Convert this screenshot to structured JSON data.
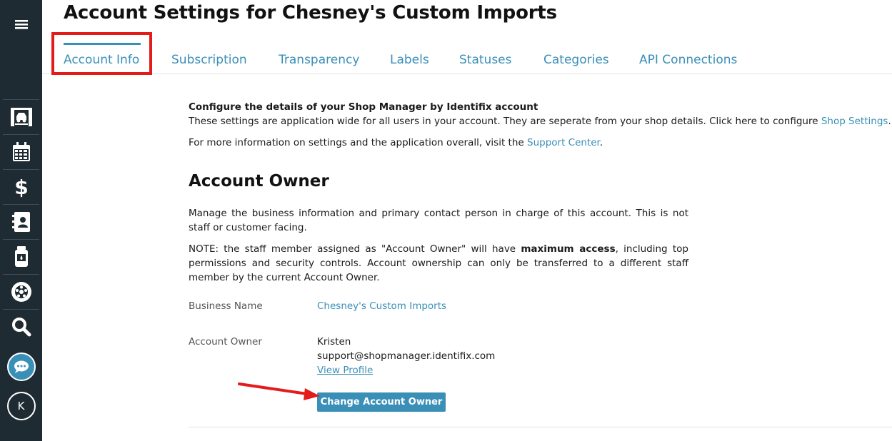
{
  "sidebar": {
    "avatar_letter": "K",
    "icons": [
      "menu-icon",
      "lift-icon",
      "calendar-icon",
      "dollar-icon",
      "contacts-icon",
      "oil-can-icon",
      "tire-icon",
      "search-icon",
      "chat-icon"
    ]
  },
  "header": {
    "title": "Account Settings for Chesney's Custom Imports"
  },
  "tabs": [
    {
      "label": "Account Info",
      "active": true
    },
    {
      "label": "Subscription"
    },
    {
      "label": "Transparency"
    },
    {
      "label": "Labels"
    },
    {
      "label": "Statuses"
    },
    {
      "label": "Categories"
    },
    {
      "label": "API Connections"
    }
  ],
  "intro": {
    "title": "Configure the details of your Shop Manager by Identifix account",
    "text_before_link": "These settings are application wide for all users in your account. They are seperate from your shop details. Click here to configure ",
    "shop_settings_link": "Shop Settings",
    "text_after_link": ".",
    "more_before_link": "For more information on settings and the application overall, visit the ",
    "support_link": "Support Center",
    "more_after_link": "."
  },
  "account_owner": {
    "section_title": "Account Owner",
    "description": "Manage the business information and primary contact person in charge of this account. This is not staff or customer facing.",
    "note_before_bold": "NOTE: the staff member assigned as \"Account Owner\" will have ",
    "note_bold": "maximum access",
    "note_after_bold": ", including top permissions and security controls. Account ownership can only be transferred to a different staff member by the current Account Owner.",
    "business_name_label": "Business Name",
    "business_name_value": "Chesney's Custom Imports",
    "owner_label": "Account Owner",
    "owner_name": "Kristen",
    "owner_email": "support@shopmanager.identifix.com",
    "view_profile_link": "View Profile",
    "change_button": "Change Account Owner"
  },
  "colors": {
    "accent": "#3a8fb7",
    "sidebar": "#1f2b33",
    "annotation": "#e41b1b"
  }
}
